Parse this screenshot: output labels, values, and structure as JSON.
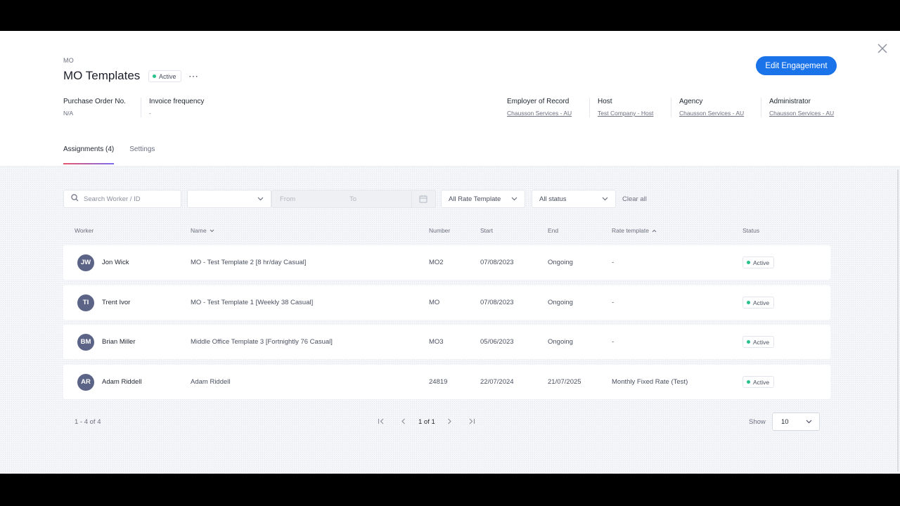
{
  "header": {
    "breadcrumb": "MO",
    "title": "MO Templates",
    "status": "Active",
    "more": "⋯",
    "edit_button": "Edit Engagement"
  },
  "meta_left": [
    {
      "label": "Purchase Order No.",
      "value": "N/A"
    },
    {
      "label": "Invoice frequency",
      "value": "-"
    }
  ],
  "meta_right": [
    {
      "label": "Employer of Record",
      "value": "Chausson Services - AU"
    },
    {
      "label": "Host",
      "value": "Test Company - Host"
    },
    {
      "label": "Agency",
      "value": "Chausson Services - AU"
    },
    {
      "label": "Administrator",
      "value": "Chausson Services - AU"
    }
  ],
  "tabs": [
    {
      "label": "Assignments (4)",
      "active": true
    },
    {
      "label": "Settings",
      "active": false
    }
  ],
  "filters": {
    "search_placeholder": "Search Worker / ID",
    "blank_select": "",
    "date_from": "From",
    "date_to": "To",
    "rate_template": "All Rate Template",
    "status": "All status",
    "clear_all": "Clear all"
  },
  "table": {
    "columns": [
      "Worker",
      "Name",
      "Number",
      "Start",
      "End",
      "Rate template",
      "Status"
    ],
    "rows": [
      {
        "initials": "JW",
        "worker": "Jon Wick",
        "name": "MO - Test Template 2 [8 hr/day Casual]",
        "number": "MO2",
        "start": "07/08/2023",
        "end": "Ongoing",
        "rate_template": "-",
        "status": "Active"
      },
      {
        "initials": "TI",
        "worker": "Trent Ivor",
        "name": "MO - Test Template 1 [Weekly 38 Casual]",
        "number": "MO",
        "start": "07/08/2023",
        "end": "Ongoing",
        "rate_template": "-",
        "status": "Active"
      },
      {
        "initials": "BM",
        "worker": "Brian Miller",
        "name": "Middle Office Template 3 [Fortnightly 76 Casual]",
        "number": "MO3",
        "start": "05/06/2023",
        "end": "Ongoing",
        "rate_template": "-",
        "status": "Active"
      },
      {
        "initials": "AR",
        "worker": "Adam Riddell",
        "name": "Adam Riddell",
        "number": "24819",
        "start": "22/07/2024",
        "end": "21/07/2025",
        "rate_template": "Monthly Fixed Rate (Test)",
        "status": "Active"
      }
    ]
  },
  "pagination": {
    "range": "1 - 4 of 4",
    "page_label": "1 of 1",
    "show_label": "Show",
    "page_size": "10"
  },
  "colors": {
    "accent": "#1a73e8",
    "active_dot": "#27c28a",
    "avatar": "#5b6386"
  }
}
